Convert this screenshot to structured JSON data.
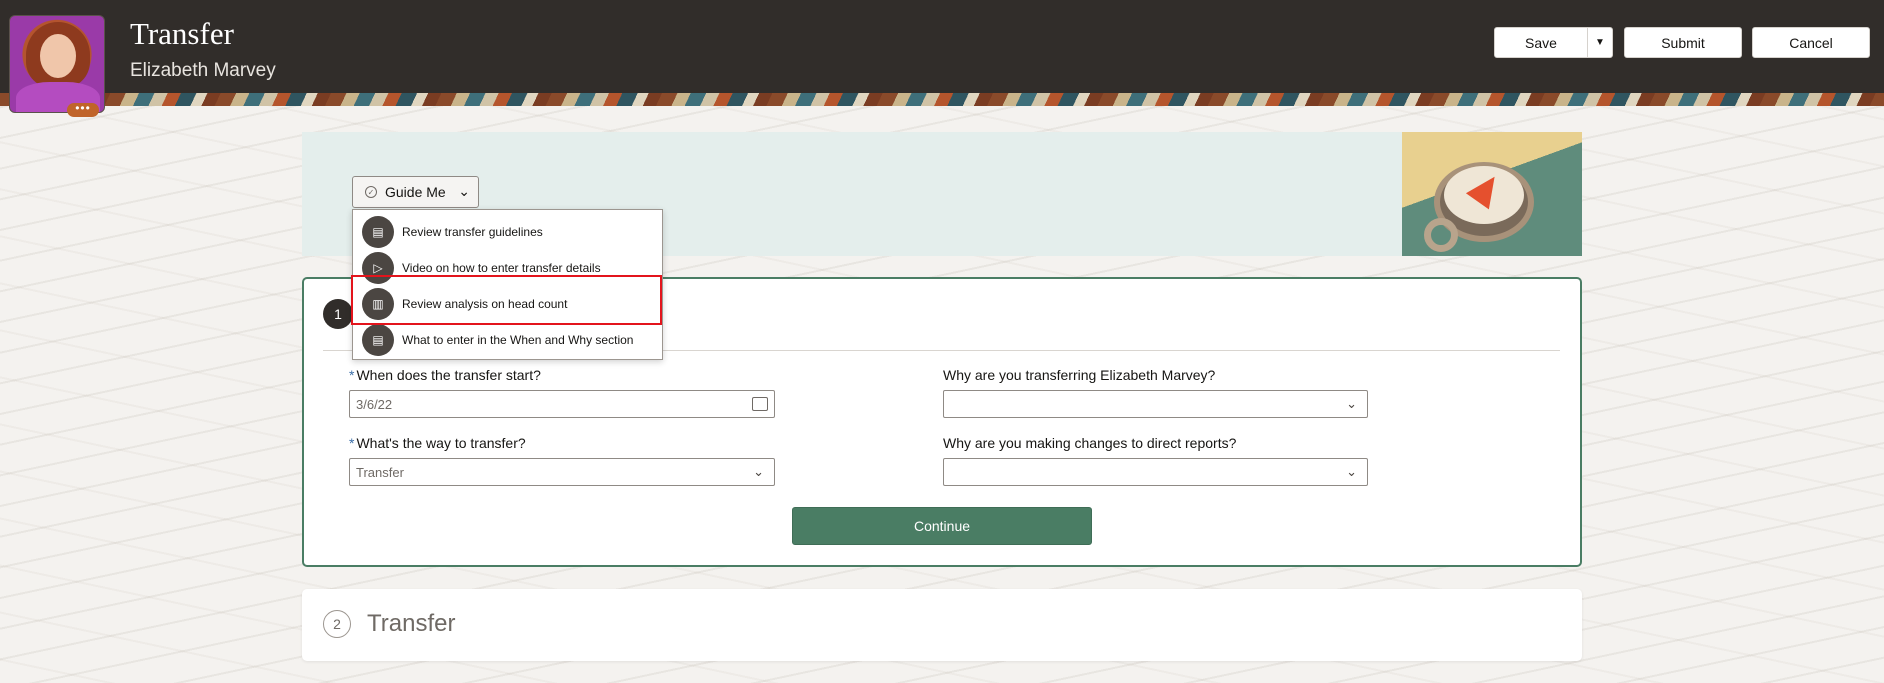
{
  "header": {
    "title": "Transfer",
    "person_name": "Elizabeth Marvey",
    "more_label": "•••",
    "save_label": "Save",
    "save_menu_icon": "▼",
    "submit_label": "Submit",
    "cancel_label": "Cancel"
  },
  "guide": {
    "button_label": "Guide Me",
    "button_icon": "check-circle-icon",
    "chevron": "⌄",
    "items": [
      {
        "label": "Review transfer guidelines",
        "icon": "chat-icon",
        "glyph": "▤"
      },
      {
        "label": "Video on how to enter transfer details",
        "icon": "play-icon",
        "glyph": "▷"
      },
      {
        "label": "Review analysis on head count",
        "icon": "bar-chart-icon",
        "glyph": "▥"
      },
      {
        "label": "What to enter in the When and Why section",
        "icon": "chat-icon",
        "glyph": "▤"
      }
    ],
    "highlighted_index": 2
  },
  "step1": {
    "number": "1",
    "fields": {
      "transfer_start": {
        "label": "When does the transfer start?",
        "required": "*",
        "value": "3/6/22"
      },
      "transfer_way": {
        "label": "What's the way to transfer?",
        "required": "*",
        "value": "Transfer"
      },
      "transfer_reason": {
        "label": "Why are you transferring Elizabeth Marvey?",
        "value": ""
      },
      "direct_reports_reason": {
        "label": "Why are you making changes to direct reports?",
        "value": ""
      }
    },
    "continue_label": "Continue"
  },
  "step2": {
    "number": "2",
    "title": "Transfer"
  },
  "colors": {
    "header_bg": "#312d2a",
    "accent_green": "#4a7d64",
    "highlight_red": "#e3141c",
    "required_blue": "#3c6fa8"
  }
}
